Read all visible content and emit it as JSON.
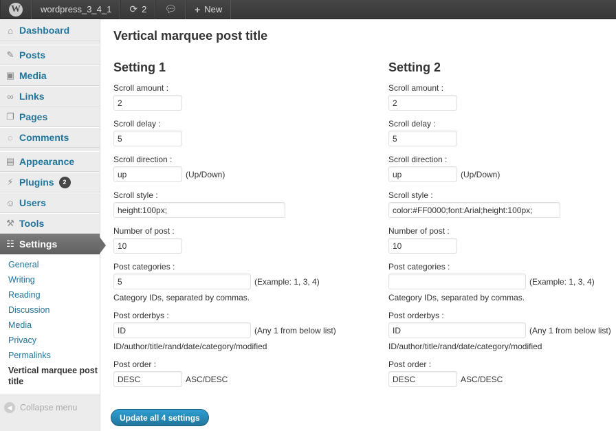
{
  "adminbar": {
    "logo_icon": "wordpress-logo-icon",
    "site_name": "wordpress_3_4_1",
    "updates_count": "2",
    "new_label": "New"
  },
  "sidebar": {
    "items": [
      {
        "label": "Dashboard",
        "icon": "home-icon"
      },
      {
        "label": "Posts",
        "icon": "pin-icon"
      },
      {
        "label": "Media",
        "icon": "media-icon"
      },
      {
        "label": "Links",
        "icon": "link-icon"
      },
      {
        "label": "Pages",
        "icon": "pages-icon"
      },
      {
        "label": "Comments",
        "icon": "comment-icon"
      },
      {
        "label": "Appearance",
        "icon": "appearance-icon"
      },
      {
        "label": "Plugins",
        "icon": "plugin-icon",
        "badge": "2"
      },
      {
        "label": "Users",
        "icon": "users-icon"
      },
      {
        "label": "Tools",
        "icon": "tools-icon"
      },
      {
        "label": "Settings",
        "icon": "settings-icon"
      }
    ],
    "submenu": [
      "General",
      "Writing",
      "Reading",
      "Discussion",
      "Media",
      "Privacy",
      "Permalinks",
      "Vertical marquee post title"
    ],
    "collapse_label": "Collapse menu"
  },
  "main": {
    "title": "Vertical marquee post title",
    "settings": [
      {
        "heading": "Setting 1",
        "scroll_amount_label": "Scroll amount :",
        "scroll_amount": "2",
        "scroll_delay_label": "Scroll delay :",
        "scroll_delay": "5",
        "scroll_direction_label": "Scroll direction :",
        "scroll_direction": "up",
        "scroll_direction_hint": "(Up/Down)",
        "scroll_style_label": "Scroll style :",
        "scroll_style": "height:100px;",
        "num_post_label": "Number of post :",
        "num_post": "10",
        "categories_label": "Post categories :",
        "categories": "5",
        "categories_hint": "(Example: 1, 3, 4)",
        "categories_desc": "Category IDs, separated by commas.",
        "orderby_label": "Post orderbys :",
        "orderby": "ID",
        "orderby_hint": "(Any 1 from below list)",
        "orderby_desc": "ID/author/title/rand/date/category/modified",
        "order_label": "Post order :",
        "order": "DESC",
        "order_hint": "ASC/DESC"
      },
      {
        "heading": "Setting 2",
        "scroll_amount_label": "Scroll amount :",
        "scroll_amount": "2",
        "scroll_delay_label": "Scroll delay :",
        "scroll_delay": "5",
        "scroll_direction_label": "Scroll direction :",
        "scroll_direction": "up",
        "scroll_direction_hint": "(Up/Down)",
        "scroll_style_label": "Scroll style :",
        "scroll_style": "color:#FF0000;font:Arial;height:100px;",
        "num_post_label": "Number of post :",
        "num_post": "10",
        "categories_label": "Post categories :",
        "categories": "",
        "categories_hint": "(Example: 1, 3, 4)",
        "categories_desc": "Category IDs, separated by commas.",
        "orderby_label": "Post orderbys :",
        "orderby": "ID",
        "orderby_hint": "(Any 1 from below list)",
        "orderby_desc": "ID/author/title/rand/date/category/modified",
        "order_label": "Post order :",
        "order": "DESC",
        "order_hint": "ASC/DESC"
      }
    ],
    "submit_label": "Update all 4 settings"
  },
  "colors": {
    "link": "#21759b",
    "adminbar_bg": "#464646",
    "button": "#21759b"
  }
}
